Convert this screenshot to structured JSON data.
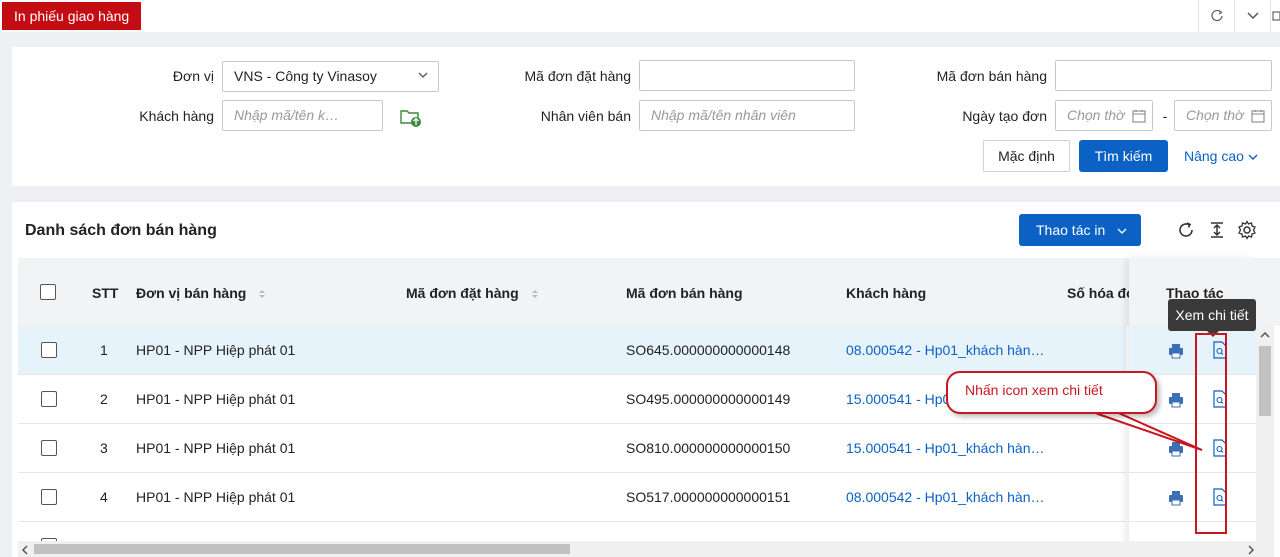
{
  "page_tab": "In phiếu giao hàng",
  "top_icons": [
    "refresh-icon",
    "chevron-down-icon",
    "fullscreen-icon"
  ],
  "filters": {
    "don_vi_label": "Đơn vị",
    "don_vi_value": "VNS - Công ty Vinasoy",
    "ma_don_dat_label": "Mã đơn đặt hàng",
    "ma_don_dat_value": "",
    "ma_don_ban_label": "Mã đơn bán hàng",
    "ma_don_ban_value": "",
    "khach_hang_label": "Khách hàng",
    "khach_hang_placeholder": "Nhập mã/tên k…",
    "nhan_vien_label": "Nhân viên bán",
    "nhan_vien_placeholder": "Nhập mã/tên nhân viên",
    "ngay_tao_label": "Ngày tạo đơn",
    "ngay_from_placeholder": "Chọn thờ",
    "ngay_sep": "-",
    "ngay_to_placeholder": "Chọn thờ",
    "btn_default": "Mặc định",
    "btn_search": "Tìm kiếm",
    "link_advanced": "Nâng cao"
  },
  "list": {
    "title": "Danh sách đơn bán hàng",
    "print_action": "Thao tác in",
    "columns": {
      "stt": "STT",
      "don_vi": "Đơn vị bán hàng",
      "ma_dat": "Mã đơn đặt hàng",
      "ma_ban": "Mã đơn bán hàng",
      "khach": "Khách hàng",
      "so_hoa_don": "Số hóa đơ",
      "thao_tac": "Thao tác"
    },
    "rows": [
      {
        "stt": "1",
        "don_vi": "HP01 - NPP Hiệp phát 01",
        "ma_dat": "",
        "ma_ban": "SO645.000000000000148",
        "khach": "08.000542 - Hp01_khách hàn…"
      },
      {
        "stt": "2",
        "don_vi": "HP01 - NPP Hiệp phát 01",
        "ma_dat": "",
        "ma_ban": "SO495.000000000000149",
        "khach": "15.000541 - Hp0"
      },
      {
        "stt": "3",
        "don_vi": "HP01 - NPP Hiệp phát 01",
        "ma_dat": "",
        "ma_ban": "SO810.000000000000150",
        "khach": "15.000541 - Hp01_khách hàn…"
      },
      {
        "stt": "4",
        "don_vi": "HP01 - NPP Hiệp phát 01",
        "ma_dat": "",
        "ma_ban": "SO517.000000000000151",
        "khach": "08.000542 - Hp01_khách hàn…"
      }
    ]
  },
  "tooltip": "Xem chi tiết",
  "callout": "Nhấn icon xem chi tiết",
  "colors": {
    "brand_red": "#c40d12",
    "primary": "#0b62c4",
    "annotation": "#c8171e"
  }
}
